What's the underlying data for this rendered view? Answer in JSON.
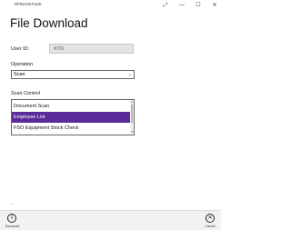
{
  "window": {
    "title": "RFIDAimTrack",
    "controls": {
      "expand": "⤢",
      "minimize": "—",
      "maximize": "☐",
      "close": "✕"
    }
  },
  "page": {
    "title": "File Download"
  },
  "user_id": {
    "label": "User ID:",
    "value": "ATIN"
  },
  "operation": {
    "label": "Operation",
    "selected": "Scan",
    "chevron": "⌄"
  },
  "scan_control": {
    "label": "Scan Control",
    "items": [
      {
        "label": "Document Scan",
        "selected": false
      },
      {
        "label": "Employee List",
        "selected": true
      },
      {
        "label": "FSO Equipment Stock Check",
        "selected": false
      }
    ],
    "scroll_up": "▴",
    "scroll_down": "▾"
  },
  "more": {
    "glyph": "…"
  },
  "app_bar": {
    "download": {
      "label": "Download",
      "icon": "download-icon",
      "glyph": "⇩"
    },
    "cancel": {
      "label": "Cancel",
      "icon": "cancel-icon",
      "glyph": "✕"
    }
  },
  "colors": {
    "selection": "#5a2a9a",
    "field_disabled": "#e3e3e3",
    "app_bar": "#f2f2f2"
  }
}
